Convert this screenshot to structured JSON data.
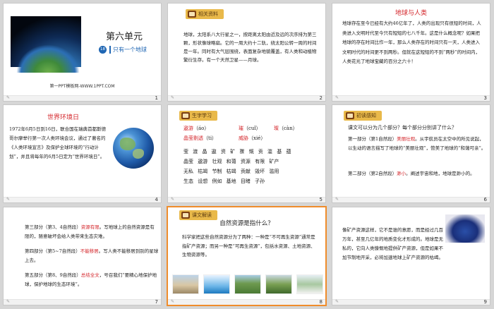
{
  "slides": [
    {
      "number": "1",
      "title": "第六单元",
      "badge": "18",
      "subtitle": "只有一个地球",
      "site": "第一PPT模板网-WWW.1PPT.COM"
    },
    {
      "number": "2",
      "tag": "相关资料",
      "text": "地球，太阳系八大行星之一，按距离太阳由近及远的次序排为第三颗，形状像球略扁。它的一周大约十二轨，绕太阳公转一周的时间是一年。同时有大气层围绕，表面复杂地貌覆盖，有人类和动植物繁衍生存。有一个天然卫星——月球。"
    },
    {
      "number": "3",
      "title": "地球与人类",
      "text": "地球存在至今已经有大约46亿年了，人类的出现只有很短的时间，人类进入文明时代至今只有短短的七八千年。这是什么概念呢？如果把地球的存在时间比作一年，那么人类存在的时间只有一天，人类进入文明时代的时间更不到两秒。但就在这短短的不到“两秒”的时间内，人类花光了地球宝藏的百分之六十！"
    },
    {
      "number": "4",
      "title": "世界环境日",
      "text": "1972年6月5日到16日，联合国在瑞典首都斯德哥尔摩举行第一次人类环境会议，通过了著名的《人类环境宣言》及保护全球环境的“行动计划”，并且将每年的6月5日定为“世界环境日”。"
    },
    {
      "number": "5",
      "tag": "生字学习",
      "vocab": [
        {
          "word": "遨游",
          "pinyin": "（áo）"
        },
        {
          "word": "璀",
          "pinyin": "（cuǐ）"
        },
        {
          "word": "璨",
          "pinyin": "（càn）"
        },
        {
          "word": "晶莹剔透",
          "pinyin": "（ti）"
        },
        {
          "word": "威胁",
          "pinyin": "（xié）"
        }
      ],
      "word_rows": [
        "莹  渡  晶  遨  资  矿  骤  慨  贡  滥  基  蕴",
        "晶莹  遨游  壮观  和蔼  资源  有限  矿产",
        "无私  枯竭  节制  枯竭  贡献  毁坏  滥用",
        "生态  设想  例如  基地  目睹  子孙"
      ]
    },
    {
      "number": "6",
      "tag": "初读感知",
      "question": "课文可以分为几个部分？每个部分分别讲了什么？",
      "parts": [
        {
          "label": "第一部分（第1自然段）",
          "key": "美丽壮观",
          "text": "。从宇航员在太空中的所见说起，以生动的语言描写了地球的“美丽壮观”，赞美了地球的“和蔼可亲”。"
        },
        {
          "label": "第二部分（第2自然段）",
          "key": "渺小",
          "text": "。阐述宇宙和地，地球是渺小的。"
        }
      ]
    },
    {
      "number": "7",
      "parts": [
        {
          "label": "第三部分（第3、4自然段）",
          "key": "资源有限",
          "text": "。写地球上的自然资源是有限的，随意破坏会给人类带来生态灾难。"
        },
        {
          "label": "第四部分（第5~7自然段）",
          "key": "不能移居",
          "text": "。写人类不能移居到别的星球上去。"
        },
        {
          "label": "第五部分（第8、9自然段）",
          "key": "总结全文",
          "text": "，号召我们“要精心地保护地球，保护地球的生态环境”。"
        }
      ]
    },
    {
      "number": "8",
      "tag": "课文解读",
      "question": "自然资源是指什么？",
      "answer": "科学家把这些自然资源分为了两种：一种是“不可再生资源”通常是指矿产资源；而另一种是“可再生资源”，包括水资源、土地资源、生物资源等。"
    },
    {
      "number": "9",
      "text": "像矿产资源这样，它不是谁的意愿，而是经过几百万年，甚至几亿年的地质变化才形成的。地球是无私的，它向人类慷慨地提供矿产资源，但是如果不加节制地开采，必将加速地球上矿产资源的枯竭。"
    }
  ]
}
